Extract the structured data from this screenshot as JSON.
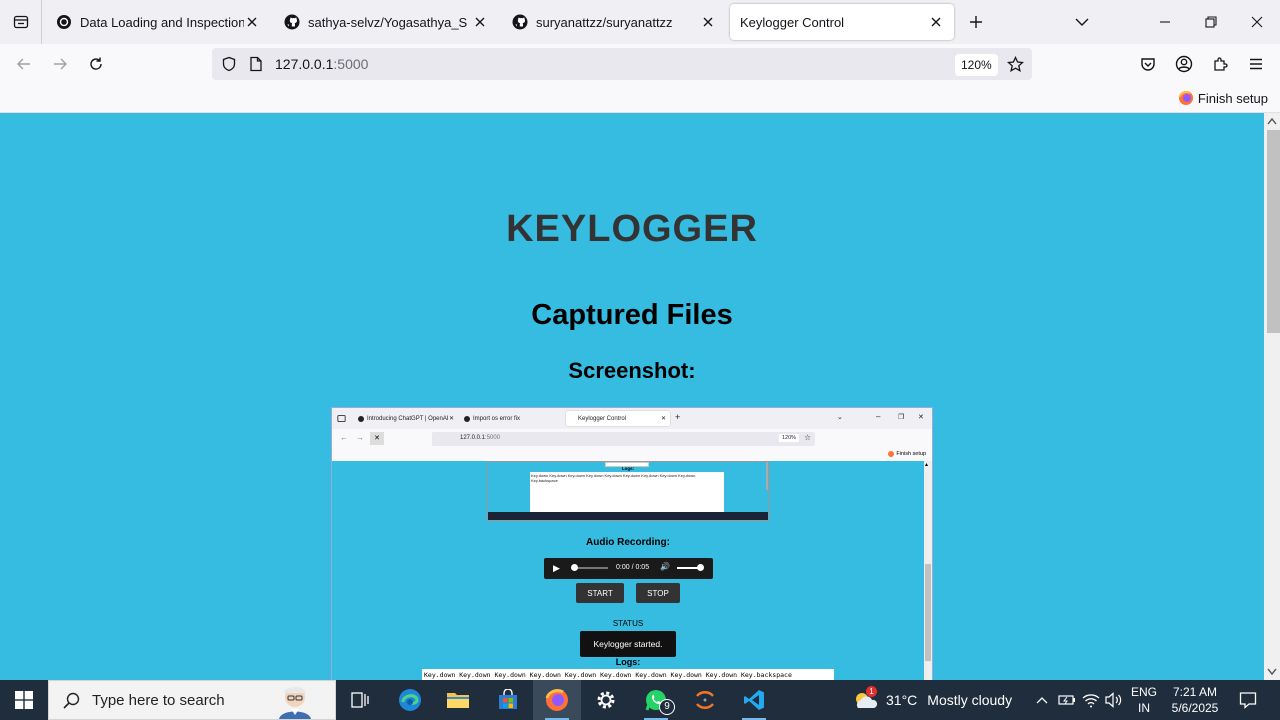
{
  "browser": {
    "tabs": [
      {
        "label": "Data Loading and Inspection",
        "icon": "openai-icon",
        "active": false
      },
      {
        "label": "sathya-selvz/Yogasathya_S",
        "icon": "github-icon",
        "active": false
      },
      {
        "label": "suryanattzz/suryanattzz",
        "icon": "github-icon",
        "active": false
      },
      {
        "label": "Keylogger Control",
        "icon": "none",
        "active": true
      }
    ],
    "url_host": "127.0.0.1",
    "url_port": ":5000",
    "zoom": "120%",
    "finish_setup": "Finish setup"
  },
  "page": {
    "title": "KEYLOGGER",
    "captured_heading": "Captured Files",
    "screenshot_heading": "Screenshot:"
  },
  "embedded_screenshot": {
    "tabs": [
      "Introducing ChatGPT | OpenAI",
      "Import os error fix",
      "Keylogger Control"
    ],
    "url_host": "127.0.0.1",
    "url_port": ":5000",
    "zoom": "120%",
    "finish_setup": "Finish setup",
    "inner_logs_label": "Logs:",
    "inner_logs_text": "Key.down Key.down Key.down Key.down Key.down Key.down Key.down Key.down Key.down Key.backspace",
    "audio_heading": "Audio Recording:",
    "audio_time": "0:00 / 0:05",
    "start_label": "START",
    "stop_label": "STOP",
    "status_label": "STATUS",
    "status_text": "Keylogger started.",
    "logs_label": "Logs:",
    "logs_text": "Key.down Key.down Key.down Key.down Key.down Key.down Key.down Key.down Key.down Key.backspace"
  },
  "taskbar": {
    "search_placeholder": "Type here to search",
    "whatsapp_badge": "9",
    "weather_badge": "1",
    "weather_temp": "31°C",
    "weather_text": "Mostly cloudy",
    "lang_1": "ENG",
    "lang_2": "IN",
    "time": "7:21 AM",
    "date": "5/6/2025"
  },
  "colors": {
    "page_bg": "#36bce1",
    "title": "#333333",
    "taskbar_bg": "#1f2d3c"
  }
}
